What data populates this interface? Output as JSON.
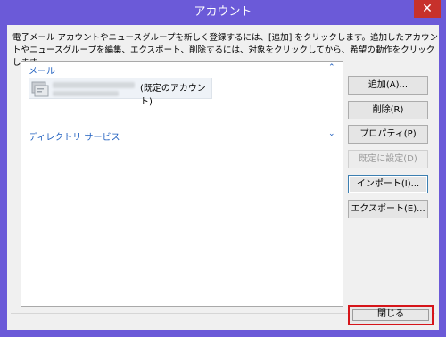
{
  "window": {
    "title": "アカウント",
    "close_glyph": "✕"
  },
  "description": "電子メール アカウントやニュースグループを新しく登録するには、[追加] をクリックします。追加したアカウントやニュースグループを編集、エクスポート、削除するには、対象をクリックしてから、希望の動作をクリックします。",
  "list": {
    "groups": [
      {
        "label": "メール",
        "expanded": true
      },
      {
        "label": "ディレクトリ サービス",
        "expanded": false
      }
    ],
    "account": {
      "default_label": "(既定のアカウント)"
    }
  },
  "buttons": {
    "add": "追加(A)...",
    "remove": "削除(R)",
    "properties": "プロパティ(P)",
    "set_default": "既定に設定(D)",
    "import": "インポート(I)...",
    "export": "エクスポート(E)...",
    "close": "閉じる"
  },
  "icons": {
    "chevron_up": "⌃",
    "chevron_down": "⌄"
  }
}
